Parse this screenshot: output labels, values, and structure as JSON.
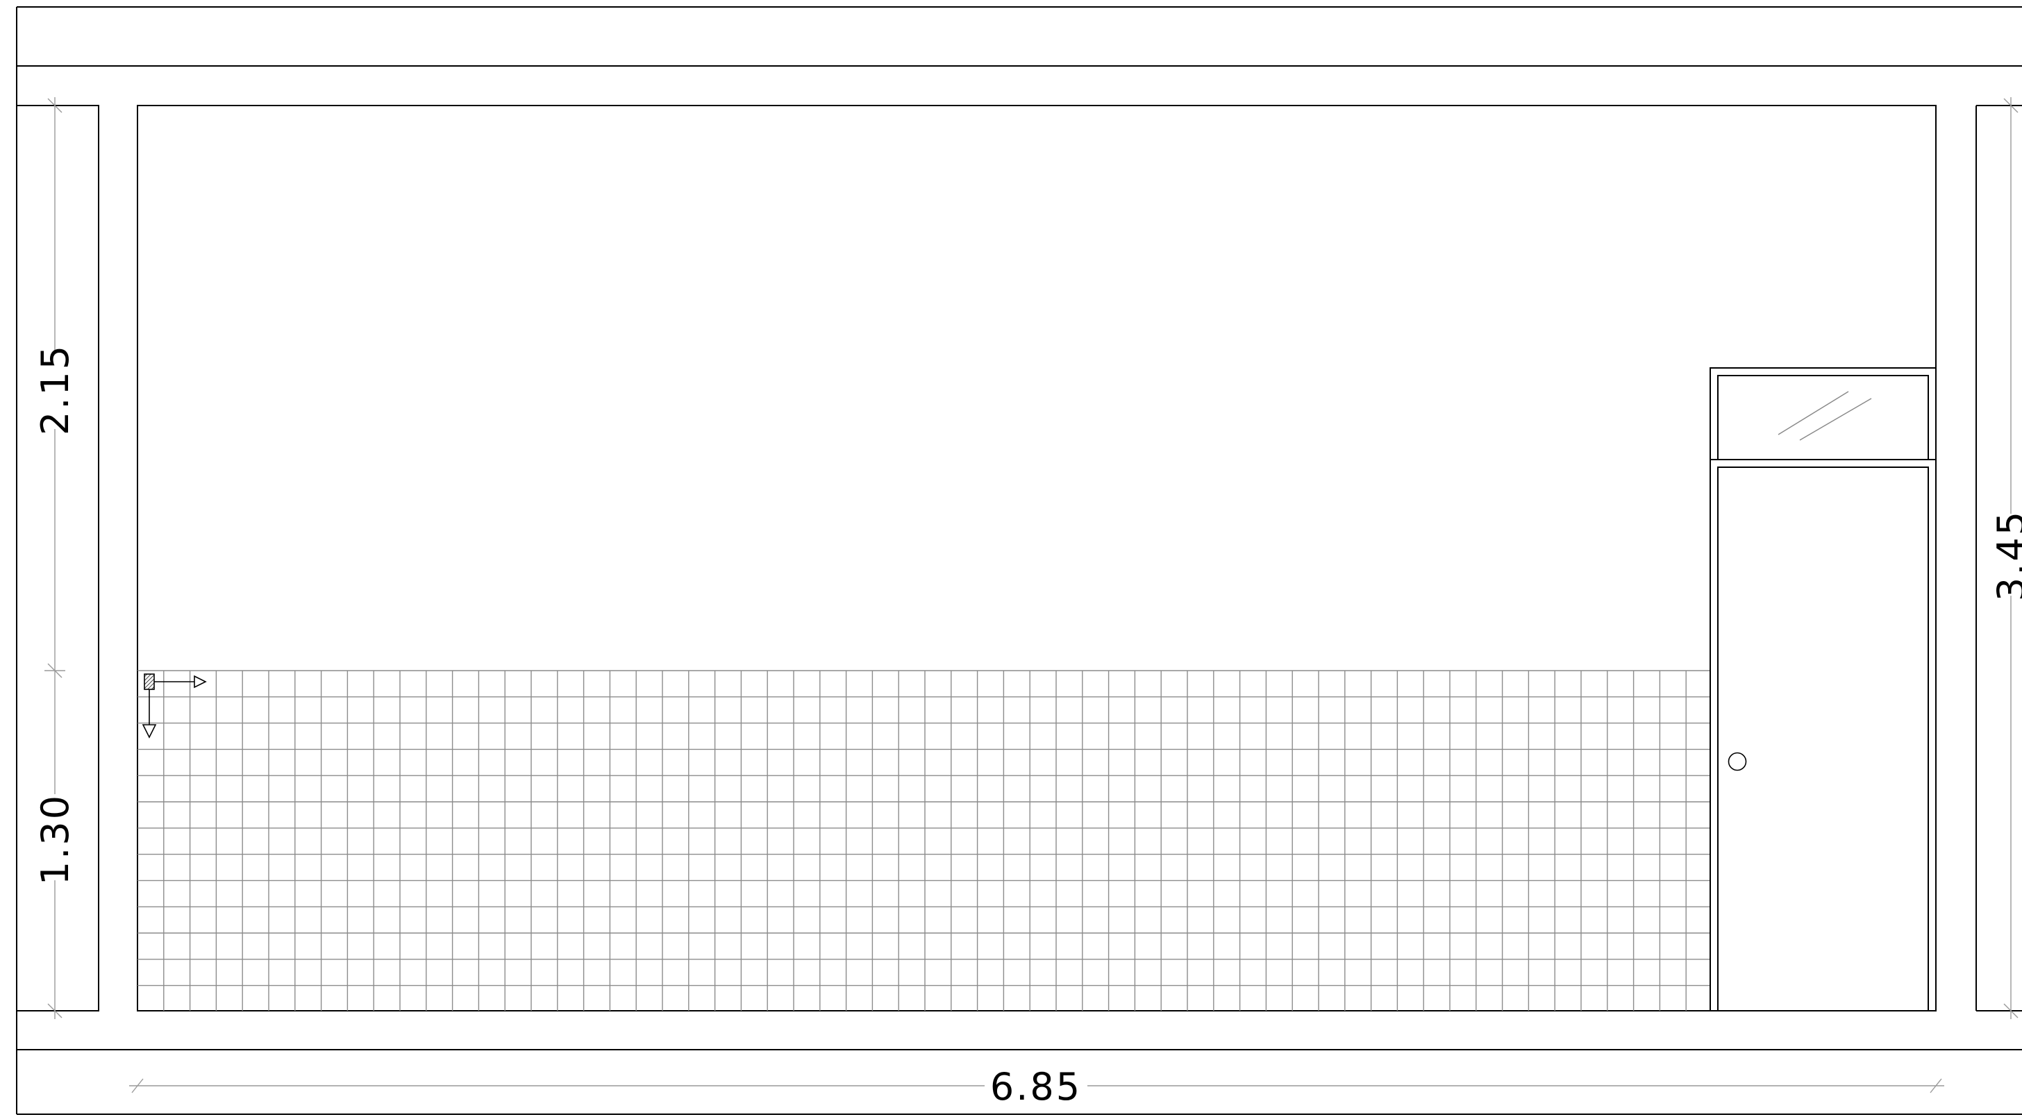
{
  "dimensions": {
    "upper_height": "2.15",
    "lower_height": "1.30",
    "total_height": "3.45",
    "total_width": "6.85"
  },
  "colors": {
    "line": "#000000",
    "grid": "#8c8c8c",
    "dimension_line": "#999999",
    "background": "#ffffff"
  }
}
